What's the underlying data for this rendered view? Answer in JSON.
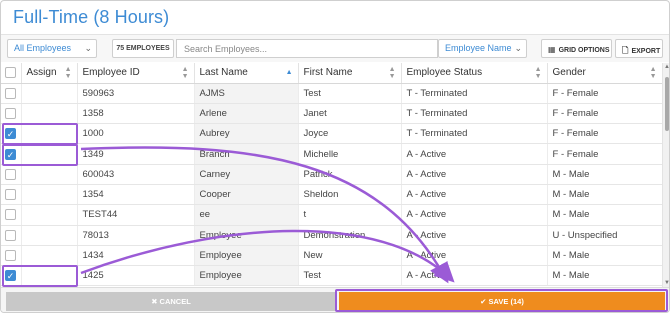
{
  "title": "Full-Time (8 Hours)",
  "toolbar": {
    "filter_value": "All Employees",
    "count_badge": "75 EMPLOYEES",
    "search_placeholder": "Search Employees...",
    "sort_value": "Employee Name",
    "grid_options": "GRID OPTIONS",
    "export": "EXPORT"
  },
  "columns": [
    "Assign",
    "Employee ID",
    "Last Name",
    "First Name",
    "Employee Status",
    "Gender"
  ],
  "rows": [
    {
      "checked": false,
      "id": "590963",
      "last": "AJMS",
      "first": "Test",
      "status": "T - Terminated",
      "gender": "F - Female"
    },
    {
      "checked": false,
      "id": "1358",
      "last": "Arlene",
      "first": "Janet",
      "status": "T - Terminated",
      "gender": "F - Female"
    },
    {
      "checked": true,
      "id": "1000",
      "last": "Aubrey",
      "first": "Joyce",
      "status": "T - Terminated",
      "gender": "F - Female"
    },
    {
      "checked": true,
      "id": "1349",
      "last": "Branch",
      "first": "Michelle",
      "status": "A - Active",
      "gender": "F - Female"
    },
    {
      "checked": false,
      "id": "600043",
      "last": "Carney",
      "first": "Patrick",
      "status": "A - Active",
      "gender": "M - Male"
    },
    {
      "checked": false,
      "id": "1354",
      "last": "Cooper",
      "first": "Sheldon",
      "status": "A - Active",
      "gender": "M - Male"
    },
    {
      "checked": false,
      "id": "TEST44",
      "last": "ee",
      "first": "t",
      "status": "A - Active",
      "gender": "M - Male"
    },
    {
      "checked": false,
      "id": "78013",
      "last": "Employee",
      "first": "Demonstration",
      "status": "A - Active",
      "gender": "U - Unspecified"
    },
    {
      "checked": false,
      "id": "1434",
      "last": "Employee",
      "first": "New",
      "status": "A - Active",
      "gender": "M - Male"
    },
    {
      "checked": true,
      "id": "1425",
      "last": "Employee",
      "first": "Test",
      "status": "A - Active",
      "gender": "M - Male"
    }
  ],
  "footer": {
    "cancel_label": "✖ CANCEL",
    "save_label": "✔ SAVE (14)"
  },
  "colors": {
    "accent": "#3d8bd4",
    "save": "#ef8c1e",
    "annotation": "#9b5bd6"
  }
}
